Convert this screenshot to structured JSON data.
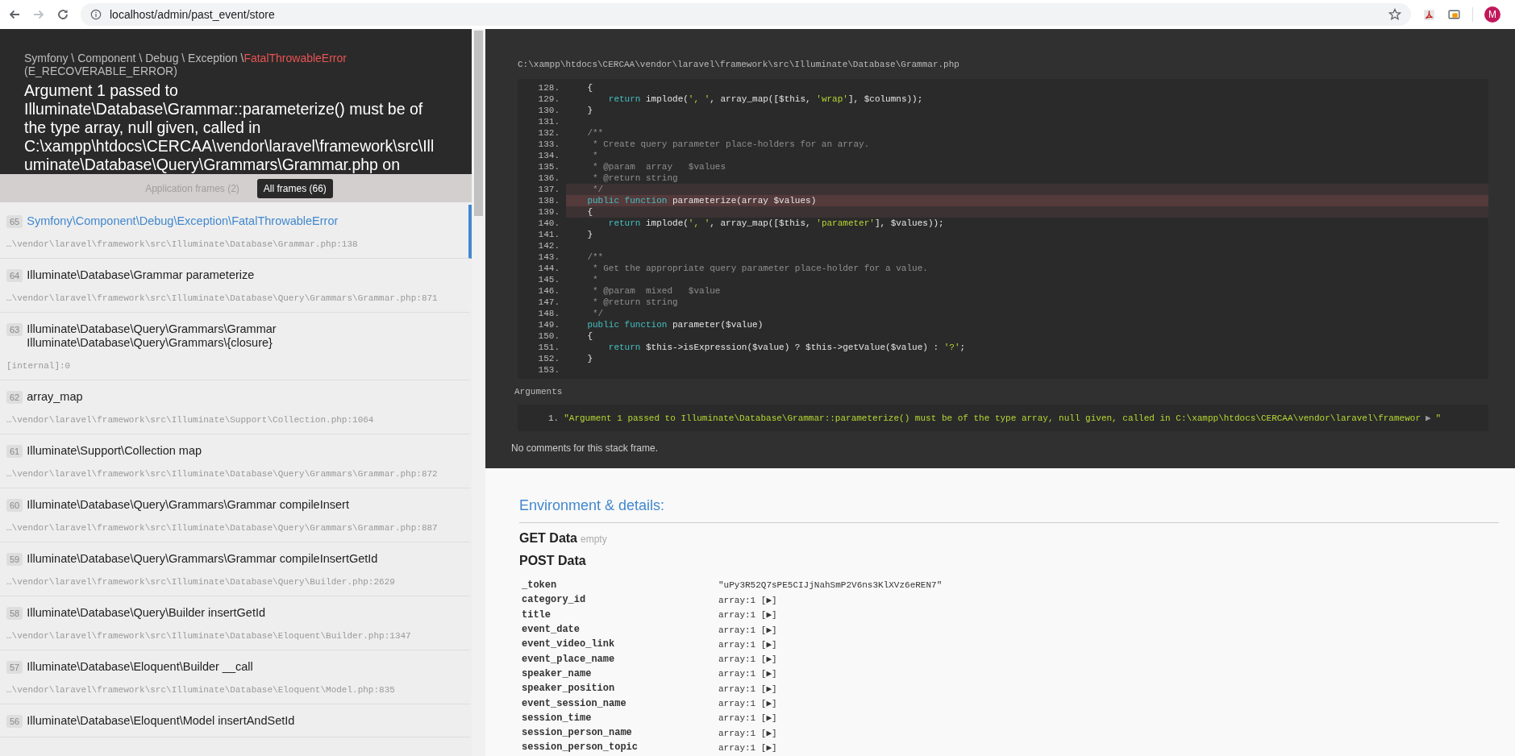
{
  "browser": {
    "url": "localhost/admin/past_event/store",
    "forward_disabled": true,
    "profile_initial": "M"
  },
  "header": {
    "namespace": "Symfony \\ Component \\ Debug \\ Exception \\",
    "exception_class": "FatalThrowableError",
    "error_code": "(E_RECOVERABLE_ERROR)",
    "message": "Argument 1 passed to Illuminate\\Database\\Grammar::parameterize() must be of the type array, null given, called in C:\\xampp\\htdocs\\CERCAA\\vendor\\laravel\\framework\\src\\Illuminate\\Database\\Query\\Grammars\\Grammar.php on"
  },
  "frame_tabs": [
    {
      "label": "Application frames (2)",
      "selected": false
    },
    {
      "label": "All frames (66)",
      "selected": true
    }
  ],
  "frames": [
    {
      "number": "65",
      "title": "Symfony\\Component\\Debug\\Exception\\FatalThrowableError",
      "file": "…\\vendor\\laravel\\framework\\src\\Illuminate\\Database\\Grammar.php:138",
      "selected": true
    },
    {
      "number": "64",
      "title": "Illuminate\\Database\\Grammar parameterize",
      "file": "…\\vendor\\laravel\\framework\\src\\Illuminate\\Database\\Query\\Grammars\\Grammar.php:871",
      "selected": false
    },
    {
      "number": "63",
      "title": "Illuminate\\Database\\Query\\Grammars\\Grammar Illuminate\\Database\\Query\\Grammars\\{closure}",
      "file": "[internal]:0",
      "selected": false
    },
    {
      "number": "62",
      "title": "array_map",
      "file": "…\\vendor\\laravel\\framework\\src\\Illuminate\\Support\\Collection.php:1064",
      "selected": false
    },
    {
      "number": "61",
      "title": "Illuminate\\Support\\Collection map",
      "file": "…\\vendor\\laravel\\framework\\src\\Illuminate\\Database\\Query\\Grammars\\Grammar.php:872",
      "selected": false
    },
    {
      "number": "60",
      "title": "Illuminate\\Database\\Query\\Grammars\\Grammar compileInsert",
      "file": "…\\vendor\\laravel\\framework\\src\\Illuminate\\Database\\Query\\Grammars\\Grammar.php:887",
      "selected": false
    },
    {
      "number": "59",
      "title": "Illuminate\\Database\\Query\\Grammars\\Grammar compileInsertGetId",
      "file": "…\\vendor\\laravel\\framework\\src\\Illuminate\\Database\\Query\\Builder.php:2629",
      "selected": false
    },
    {
      "number": "58",
      "title": "Illuminate\\Database\\Query\\Builder insertGetId",
      "file": "…\\vendor\\laravel\\framework\\src\\Illuminate\\Database\\Eloquent\\Builder.php:1347",
      "selected": false
    },
    {
      "number": "57",
      "title": "Illuminate\\Database\\Eloquent\\Builder __call",
      "file": "…\\vendor\\laravel\\framework\\src\\Illuminate\\Database\\Eloquent\\Model.php:835",
      "selected": false
    },
    {
      "number": "56",
      "title": "Illuminate\\Database\\Eloquent\\Model insertAndSetId",
      "selected": false
    }
  ],
  "code": {
    "file": "C:\\xampp\\htdocs\\CERCAA\\vendor\\laravel\\framework\\src\\Illuminate\\Database\\Grammar.php",
    "lines": [
      {
        "number": "128.",
        "tokens": [
          {
            "kind": "plain",
            "text": "    {"
          }
        ]
      },
      {
        "number": "129.",
        "tokens": [
          {
            "kind": "keyword",
            "text": "        return"
          },
          {
            "kind": "plain",
            "text": " implode("
          },
          {
            "kind": "string",
            "text": "', '"
          },
          {
            "kind": "plain",
            "text": ", array_map([$this, "
          },
          {
            "kind": "string",
            "text": "'wrap'"
          },
          {
            "kind": "plain",
            "text": "], $columns));"
          }
        ]
      },
      {
        "number": "130.",
        "tokens": [
          {
            "kind": "plain",
            "text": "    }"
          }
        ]
      },
      {
        "number": "131."
      },
      {
        "number": "132.",
        "tokens": [
          {
            "kind": "comment",
            "text": "    /**"
          }
        ]
      },
      {
        "number": "133.",
        "tokens": [
          {
            "kind": "comment",
            "text": "     * Create query parameter place-holders for an array."
          }
        ]
      },
      {
        "number": "134.",
        "tokens": [
          {
            "kind": "comment",
            "text": "     *"
          }
        ]
      },
      {
        "number": "135.",
        "tokens": [
          {
            "kind": "comment",
            "text": "     * @param  array   $values"
          }
        ]
      },
      {
        "number": "136.",
        "tokens": [
          {
            "kind": "comment",
            "text": "     * @return string"
          }
        ]
      },
      {
        "number": "137.",
        "context": true,
        "tokens": [
          {
            "kind": "comment",
            "text": "     */"
          }
        ]
      },
      {
        "number": "138.",
        "highlighted": true,
        "tokens": [
          {
            "kind": "keyword",
            "text": "    public function"
          },
          {
            "kind": "plain",
            "text": " parameterize(array $values)"
          }
        ]
      },
      {
        "number": "139.",
        "context": true,
        "tokens": [
          {
            "kind": "plain",
            "text": "    {"
          }
        ]
      },
      {
        "number": "140.",
        "tokens": [
          {
            "kind": "keyword",
            "text": "        return"
          },
          {
            "kind": "plain",
            "text": " implode("
          },
          {
            "kind": "string",
            "text": "', '"
          },
          {
            "kind": "plain",
            "text": ", array_map([$this, "
          },
          {
            "kind": "string",
            "text": "'parameter'"
          },
          {
            "kind": "plain",
            "text": "], $values));"
          }
        ]
      },
      {
        "number": "141.",
        "tokens": [
          {
            "kind": "plain",
            "text": "    }"
          }
        ]
      },
      {
        "number": "142."
      },
      {
        "number": "143.",
        "tokens": [
          {
            "kind": "comment",
            "text": "    /**"
          }
        ]
      },
      {
        "number": "144.",
        "tokens": [
          {
            "kind": "comment",
            "text": "     * Get the appropriate query parameter place-holder for a value."
          }
        ]
      },
      {
        "number": "145.",
        "tokens": [
          {
            "kind": "comment",
            "text": "     *"
          }
        ]
      },
      {
        "number": "146.",
        "tokens": [
          {
            "kind": "comment",
            "text": "     * @param  mixed   $value"
          }
        ]
      },
      {
        "number": "147.",
        "tokens": [
          {
            "kind": "comment",
            "text": "     * @return string"
          }
        ]
      },
      {
        "number": "148.",
        "tokens": [
          {
            "kind": "comment",
            "text": "     */"
          }
        ]
      },
      {
        "number": "149.",
        "tokens": [
          {
            "kind": "keyword",
            "text": "    public function"
          },
          {
            "kind": "plain",
            "text": " parameter($value)"
          }
        ]
      },
      {
        "number": "150.",
        "tokens": [
          {
            "kind": "plain",
            "text": "    {"
          }
        ]
      },
      {
        "number": "151.",
        "tokens": [
          {
            "kind": "keyword",
            "text": "        return"
          },
          {
            "kind": "plain",
            "text": " $this->isExpression($value) ? $this->getValue($value) : "
          },
          {
            "kind": "string",
            "text": "'?'"
          },
          {
            "kind": "plain",
            "text": ";"
          }
        ]
      },
      {
        "number": "152.",
        "tokens": [
          {
            "kind": "plain",
            "text": "    }"
          }
        ]
      },
      {
        "number": "153."
      }
    ]
  },
  "arguments": {
    "label": "Arguments",
    "items": [
      {
        "number": "1.",
        "text": "\"Argument 1 passed to Illuminate\\Database\\Grammar::parameterize() must be of the type array, null given, called in C:\\xampp\\htdocs\\CERCAA\\vendor\\laravel\\framewor",
        "toggle": "▶",
        "close": "\""
      }
    ]
  },
  "comments": "No comments for this stack frame.",
  "environment": {
    "title": "Environment & details:",
    "get": {
      "title": "GET Data",
      "note": "empty"
    },
    "post": {
      "title": "POST Data",
      "rows": [
        {
          "key": "_token",
          "value": "\"uPy3R52Q7sPE5CIJjNahSmP2V6ns3KlXVz6eREN7\""
        },
        {
          "key": "category_id",
          "value": "array:1 [▶]"
        },
        {
          "key": "title",
          "value": "array:1 [▶]"
        },
        {
          "key": "event_date",
          "value": "array:1 [▶]"
        },
        {
          "key": "event_video_link",
          "value": "array:1 [▶]"
        },
        {
          "key": "event_place_name",
          "value": "array:1 [▶]"
        },
        {
          "key": "speaker_name",
          "value": "array:1 [▶]"
        },
        {
          "key": "speaker_position",
          "value": "array:1 [▶]"
        },
        {
          "key": "event_session_name",
          "value": "array:1 [▶]"
        },
        {
          "key": "session_time",
          "value": "array:1 [▶]"
        },
        {
          "key": "session_person_name",
          "value": "array:1 [▶]"
        },
        {
          "key": "session_person_topic",
          "value": "array:1 [▶]"
        }
      ]
    }
  }
}
